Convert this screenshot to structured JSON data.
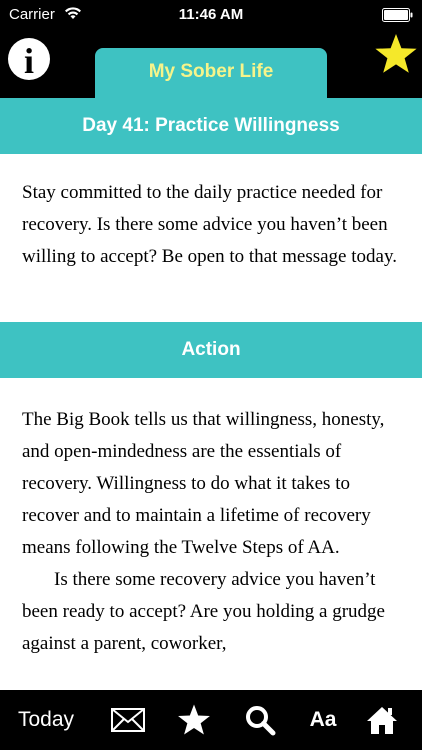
{
  "status_bar": {
    "carrier": "Carrier",
    "time": "11:46 AM"
  },
  "header": {
    "info_glyph": "i",
    "app_title": "My Sober Life",
    "star_icon": "star-icon",
    "accent_color": "#3ec2c2",
    "title_color": "#f6f48a",
    "star_color": "#f5e82a"
  },
  "day": {
    "title": "Day 41: Practice Willingness",
    "reading": "Stay committed to the daily practice needed for recovery. Is there some advice you haven’t been willing to accept? Be open to that message today."
  },
  "action": {
    "heading": "Action",
    "paragraphs": [
      "The Big Book tells us that willingness, honesty, and open-mindedness are the essentials of recovery. Willingness to do what it takes to recover and to maintain a lifetime of recovery means following the Twelve Steps of AA.",
      "Is there some recovery advice you haven’t been ready to accept? Are you holding a grudge against a parent, coworker,"
    ]
  },
  "toolbar": {
    "today_label": "Today",
    "mail_icon": "mail-icon",
    "favorites_icon": "star-icon",
    "search_icon": "search-icon",
    "font_label": "Aa",
    "home_icon": "home-icon"
  }
}
